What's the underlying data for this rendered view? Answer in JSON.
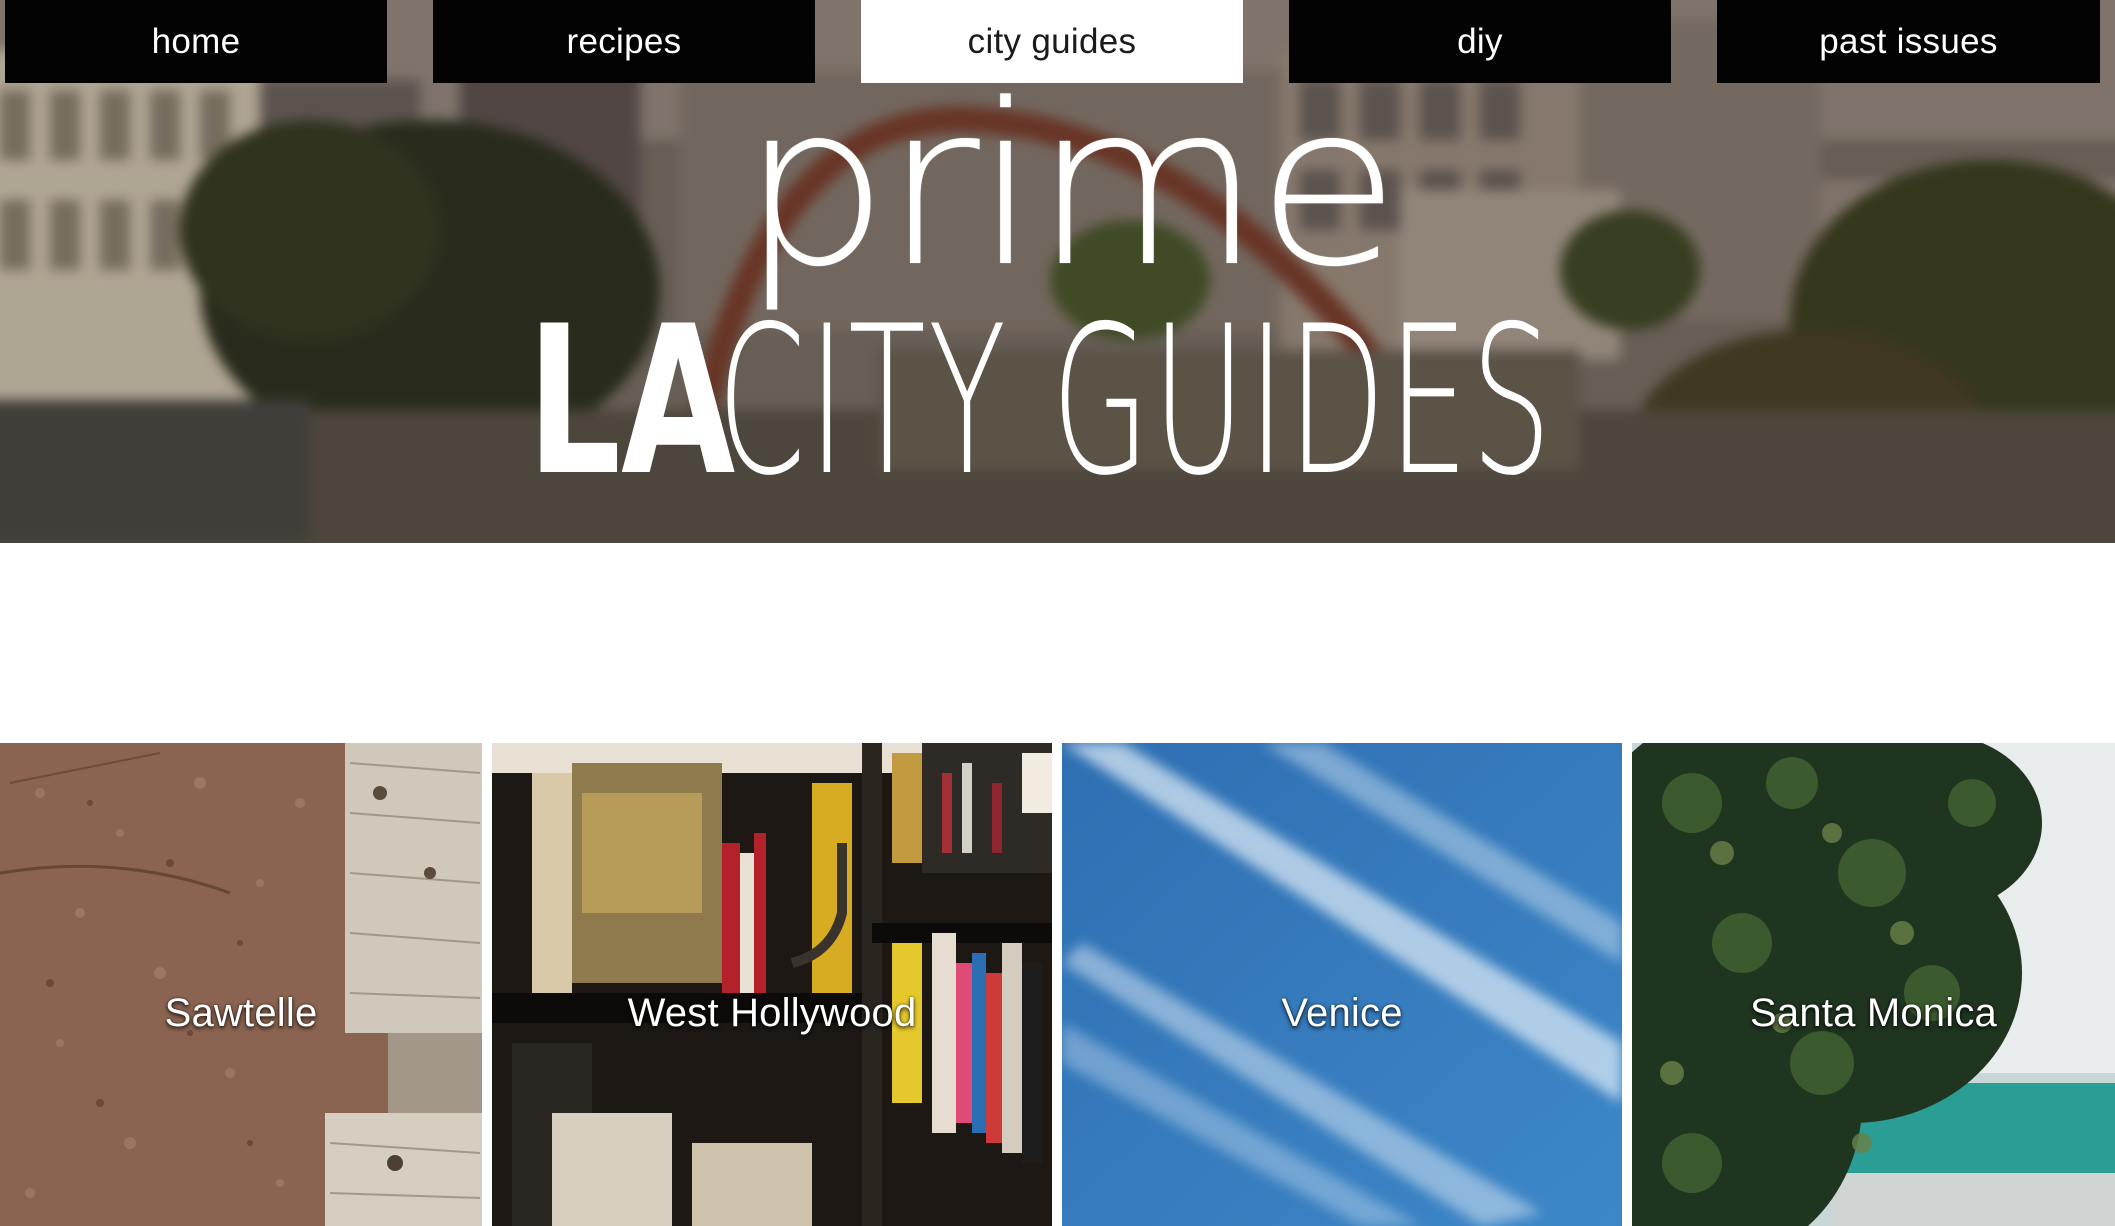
{
  "nav": {
    "items": [
      {
        "label": "home",
        "active": false
      },
      {
        "label": "recipes",
        "active": false
      },
      {
        "label": "city guides",
        "active": true
      },
      {
        "label": "diy",
        "active": false
      },
      {
        "label": "past issues",
        "active": false
      }
    ]
  },
  "hero": {
    "brand": "prime",
    "headline_la": "LA",
    "headline_rest": "CITY GUIDES"
  },
  "neighborhoods": [
    {
      "label": "Sawtelle"
    },
    {
      "label": "West Hollywood"
    },
    {
      "label": "Venice"
    },
    {
      "label": "Santa Monica"
    }
  ],
  "colors": {
    "nav_bg": "#030303",
    "nav_active_bg": "#ffffff",
    "text_light": "#ffffff"
  }
}
